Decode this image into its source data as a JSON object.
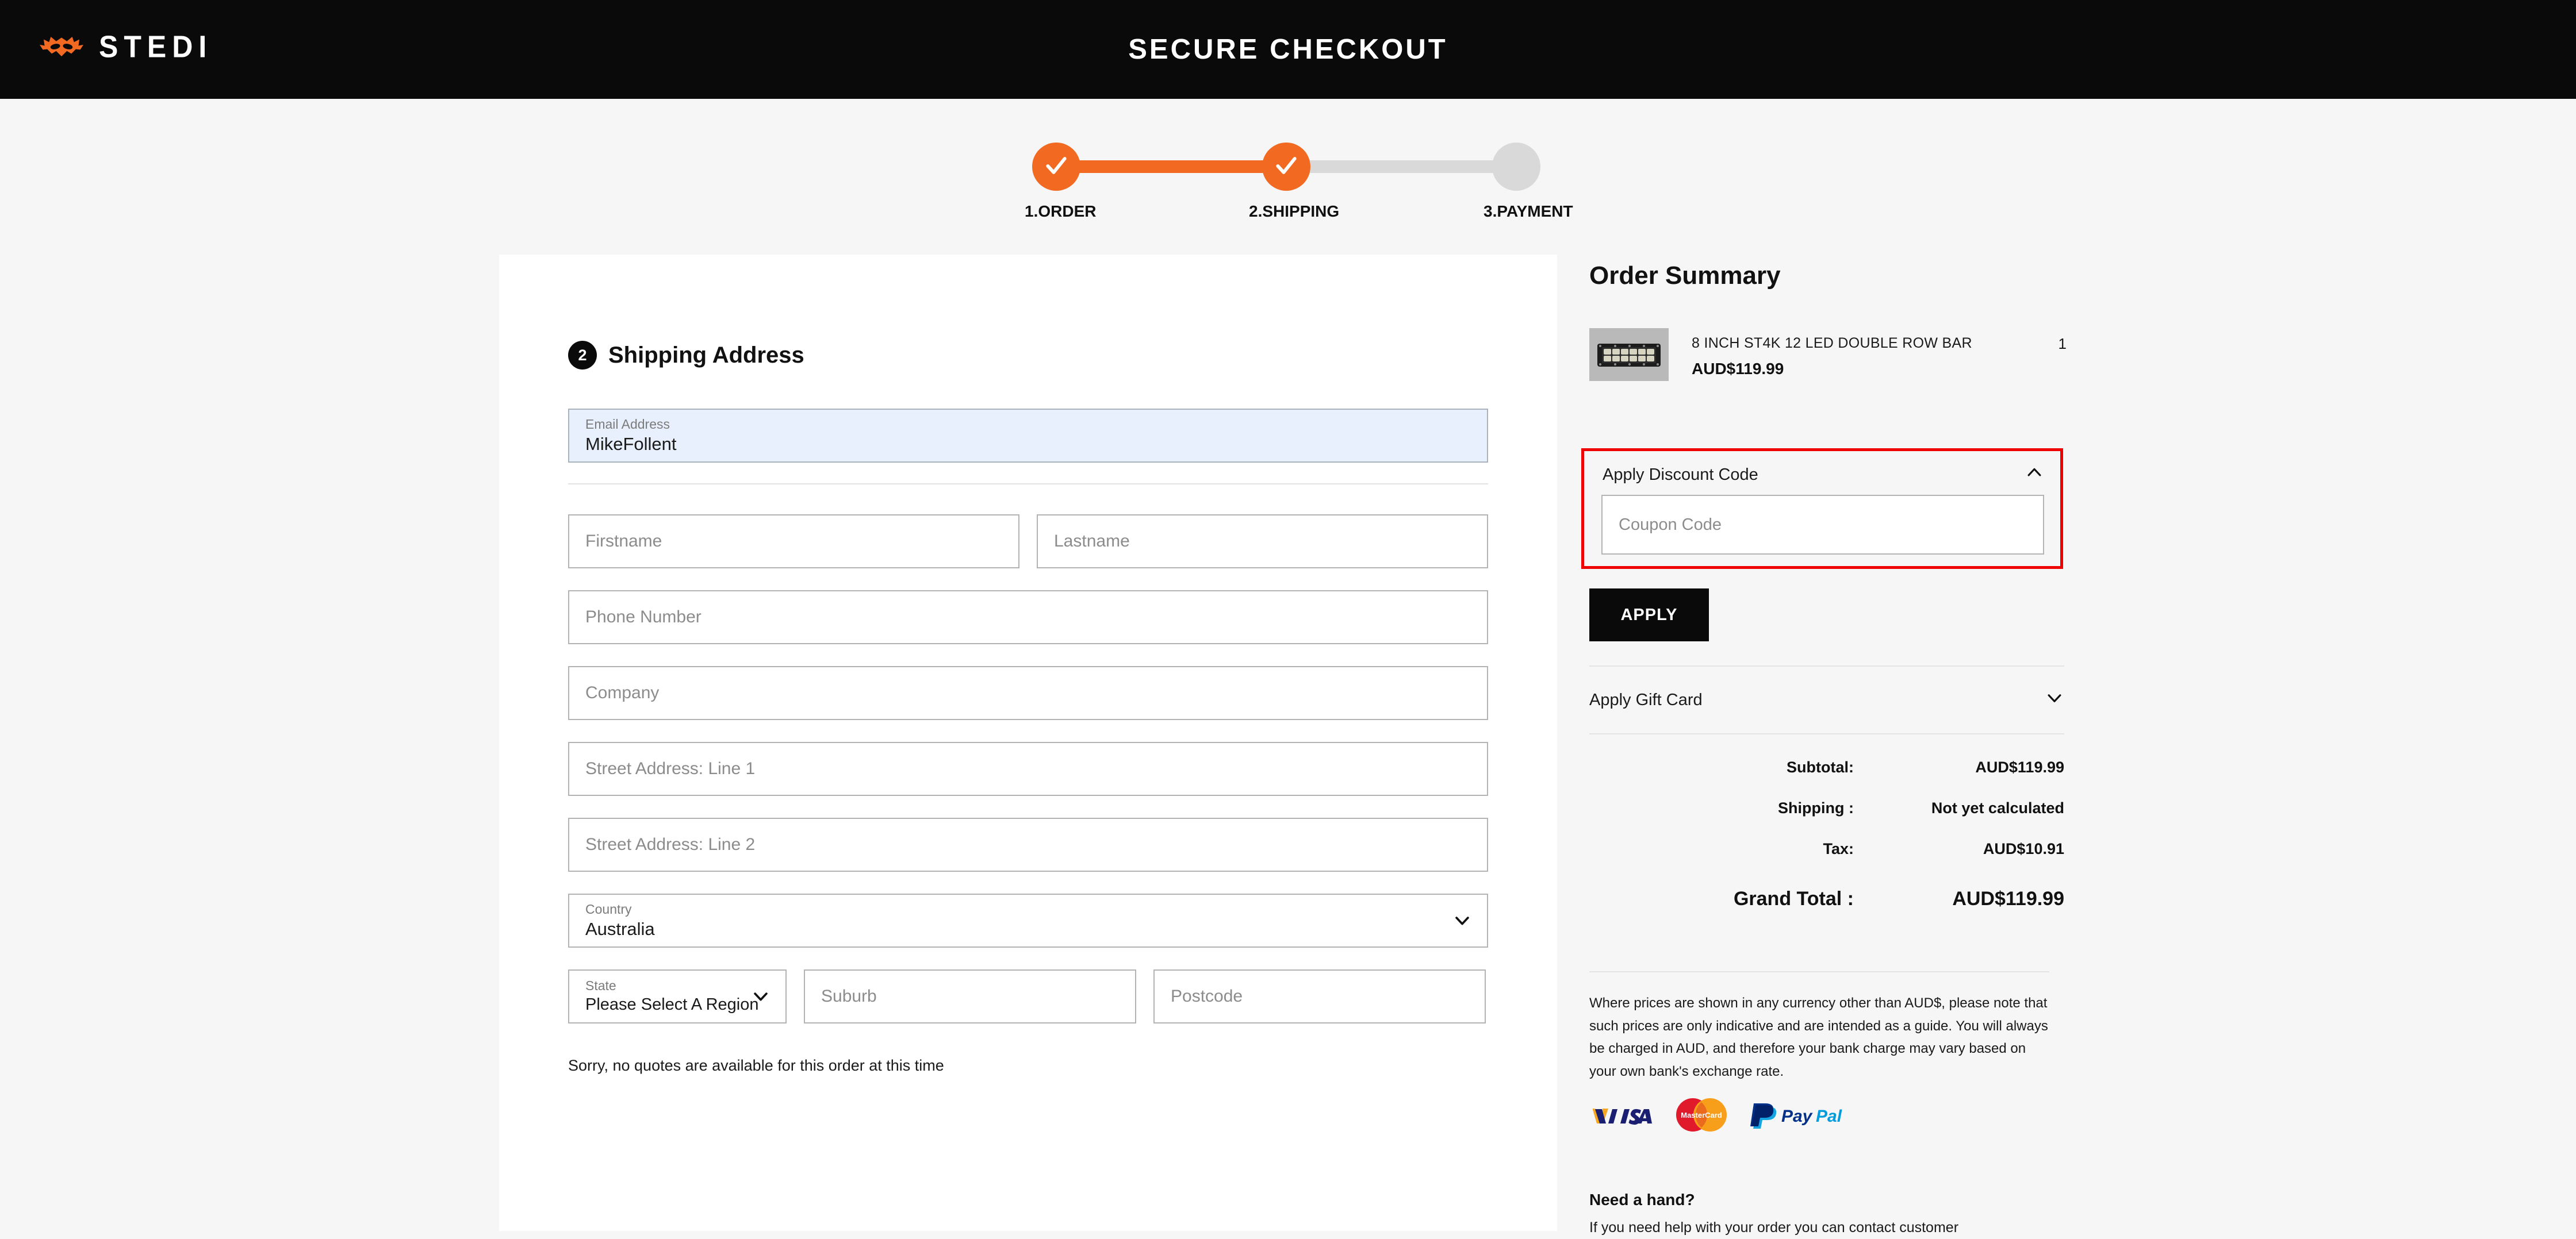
{
  "brand": {
    "name": "STEDI",
    "logo_icon": "stedi-wings-icon",
    "accent_color": "#f26a21"
  },
  "header": {
    "title": "SECURE CHECKOUT"
  },
  "stepper": {
    "steps": [
      {
        "label": "1.ORDER",
        "state": "done"
      },
      {
        "label": "2.SHIPPING",
        "state": "done"
      },
      {
        "label": "3.PAYMENT",
        "state": "todo"
      }
    ]
  },
  "shipping": {
    "step_number": "2",
    "title": "Shipping Address",
    "email": {
      "label": "Email Address",
      "value": "MikeFollent"
    },
    "firstname_placeholder": "Firstname",
    "lastname_placeholder": "Lastname",
    "phone_placeholder": "Phone Number",
    "company_placeholder": "Company",
    "street1_placeholder": "Street Address: Line 1",
    "street2_placeholder": "Street Address: Line 2",
    "country": {
      "label": "Country",
      "value": "Australia"
    },
    "state": {
      "label": "State",
      "value": "Please Select A Region, State Or Province"
    },
    "suburb_placeholder": "Suburb",
    "postcode_placeholder": "Postcode",
    "quote_note": "Sorry, no quotes are available for this order at this time"
  },
  "summary": {
    "title": "Order Summary",
    "product": {
      "name": "8 INCH ST4K 12 LED DOUBLE ROW BAR",
      "price": "AUD$119.99",
      "quantity": "1",
      "image_icon": "led-light-bar-image"
    },
    "discount": {
      "heading": "Apply Discount Code",
      "toggle_icon": "chevron-up-icon",
      "coupon_placeholder": "Coupon Code",
      "apply_label": "APPLY",
      "highlight_color": "#ee0000"
    },
    "giftcard": {
      "heading": "Apply Gift Card",
      "toggle_icon": "chevron-down-icon"
    },
    "totals": [
      {
        "label": "Subtotal:",
        "value": "AUD$119.99"
      },
      {
        "label": "Shipping :",
        "value": "Not yet calculated"
      },
      {
        "label": "Tax:",
        "value": "AUD$10.91"
      }
    ],
    "grand_total": {
      "label": "Grand Total :",
      "value": "AUD$119.99"
    },
    "fx_note": "Where prices are shown in any currency other than AUD$, please note that such prices are only indicative and are intended as a guide. You will always be charged in AUD, and therefore your bank charge may vary based on your own bank's exchange rate.",
    "payment_icons": [
      "visa-icon",
      "mastercard-icon",
      "paypal-icon"
    ],
    "help": {
      "title": "Need a hand?",
      "body": "If you need help with your order you can contact customer"
    }
  }
}
